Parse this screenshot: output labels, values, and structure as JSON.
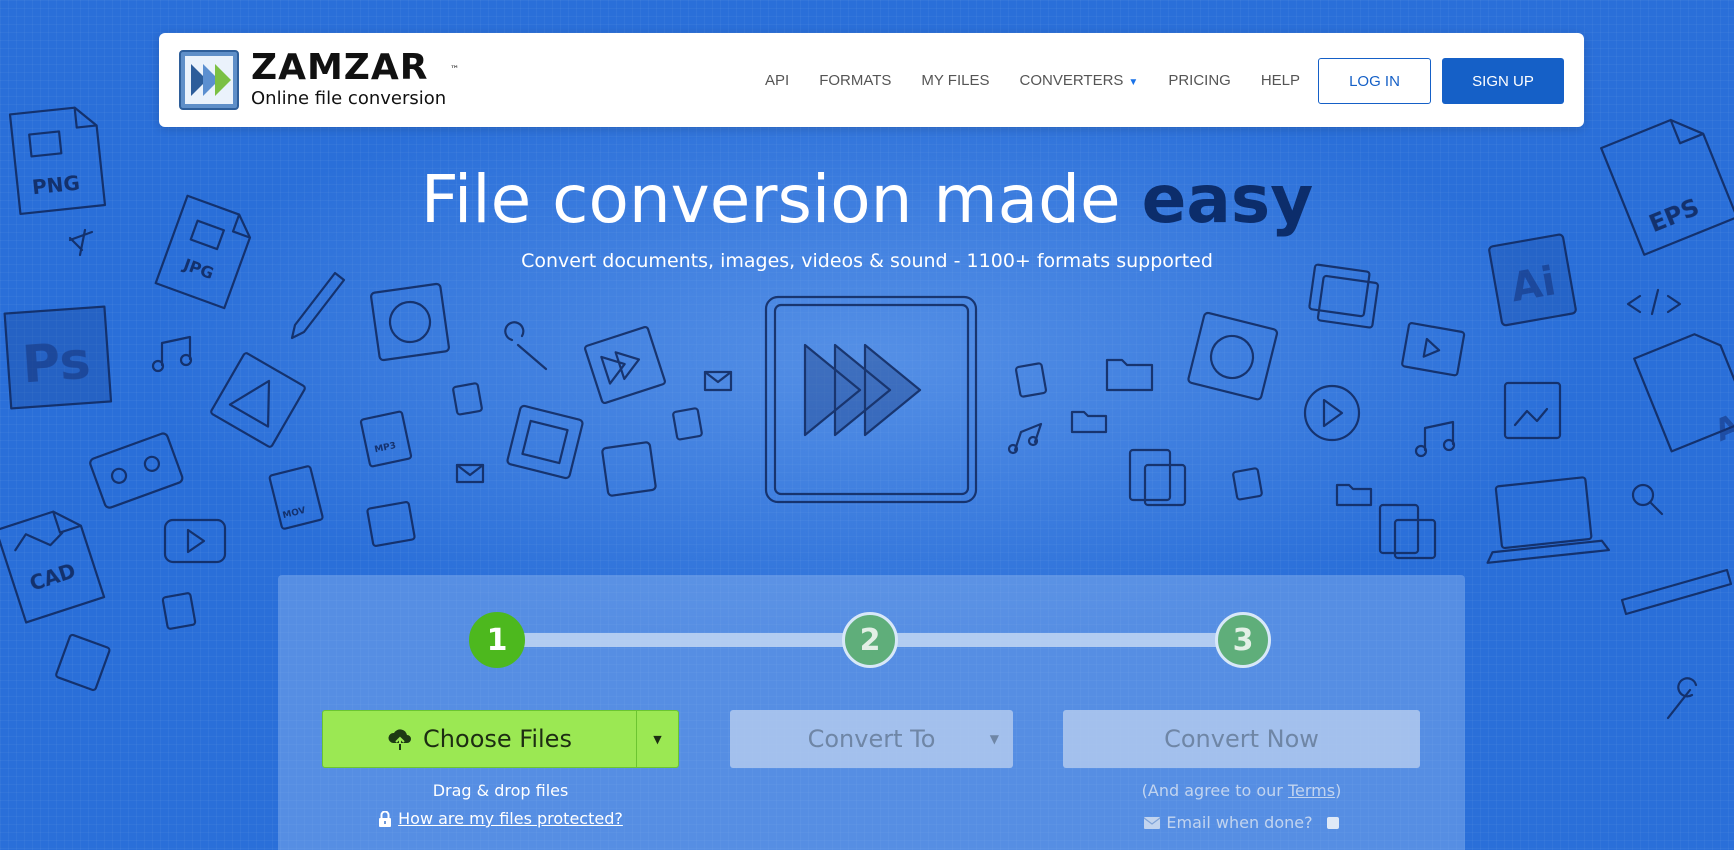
{
  "brand": {
    "name": "ZAMZAR",
    "tm": "™",
    "tagline": "Online file conversion"
  },
  "nav": {
    "items": [
      "API",
      "FORMATS",
      "MY FILES",
      "CONVERTERS",
      "PRICING",
      "HELP"
    ],
    "login": "LOG IN",
    "signup": "SIGN UP"
  },
  "hero": {
    "title_main": "File conversion made ",
    "title_emphasis": "easy",
    "subtitle": "Convert documents, images, videos & sound - 1100+ formats supported"
  },
  "doodle_labels": {
    "png": "PNG",
    "jpg": "JPG",
    "ps": "Ps",
    "cad": "CAD",
    "mp3": "MP3",
    "mov": "MOV",
    "eps": "EPS",
    "ai": "Ai",
    "ai2": "Ai"
  },
  "converter": {
    "steps": [
      "1",
      "2",
      "3"
    ],
    "choose_files": "Choose Files",
    "convert_to": "Convert To",
    "convert_now": "Convert Now",
    "drag_drop": "Drag & drop files",
    "protected_link": "How are my files protected?",
    "agree_prefix": "(And agree to our ",
    "terms": "Terms",
    "agree_suffix": ")",
    "email_label": "Email when done?"
  },
  "colors": {
    "brand_blue": "#1560c7",
    "background": "#2a6fd9",
    "choose_green": "#9be853",
    "step_active": "#4db81e",
    "title_dark": "#0c2d6b"
  }
}
